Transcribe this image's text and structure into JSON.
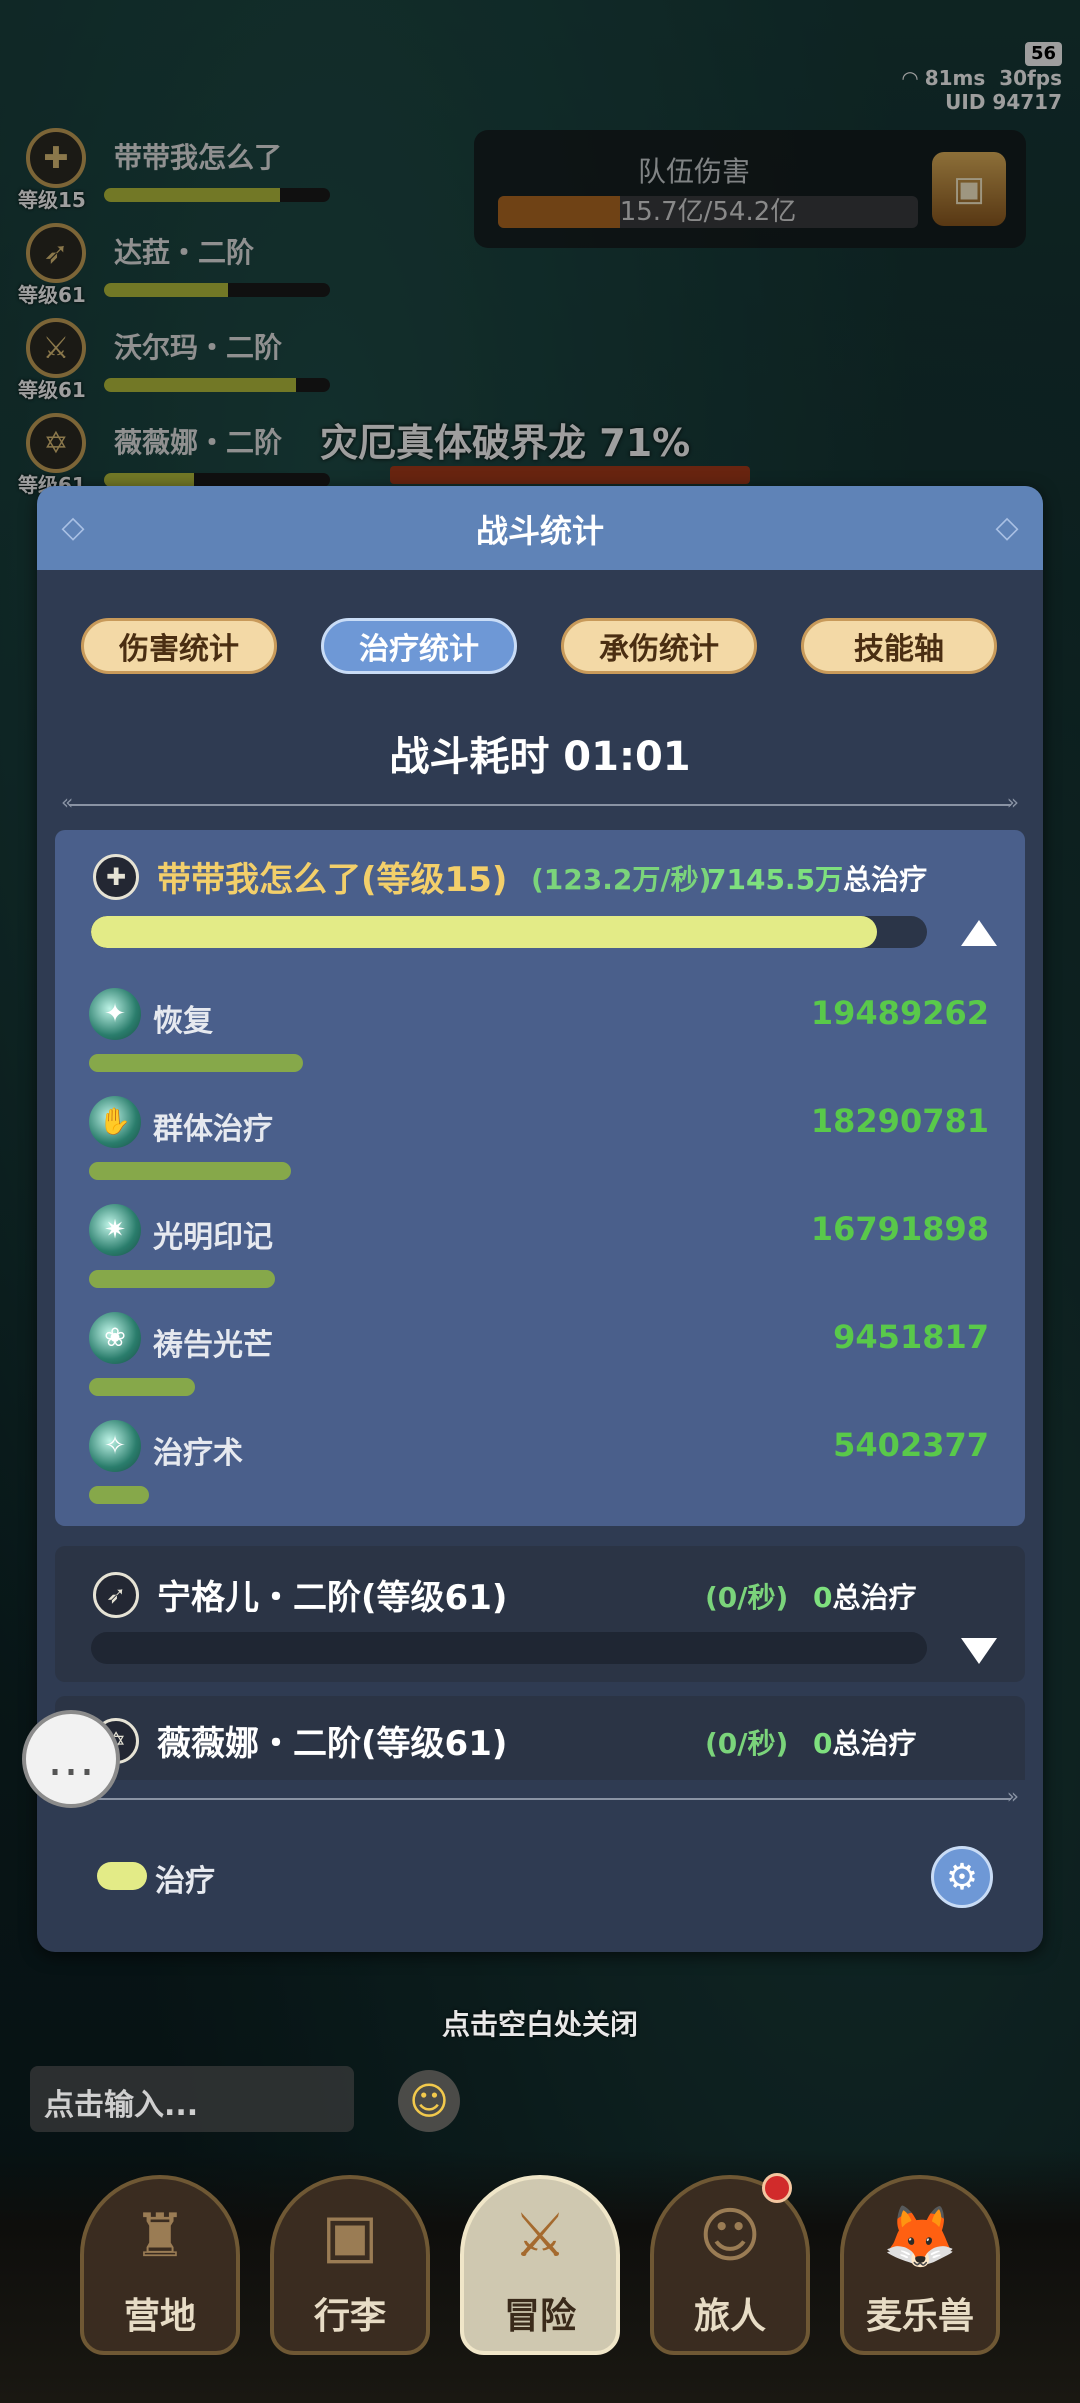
{
  "status": {
    "battery": "56",
    "ping": "81ms",
    "fps": "30fps",
    "uid_label": "UID",
    "uid": "94717"
  },
  "party": [
    {
      "name": "带带我怎么了",
      "level": "等级15",
      "hp_fraction": 0.78
    },
    {
      "name": "达菈・二阶",
      "level": "等级61",
      "hp_fraction": 0.55
    },
    {
      "name": "沃尔玛・二阶",
      "level": "等级61",
      "hp_fraction": 0.85
    },
    {
      "name": "薇薇娜・二阶",
      "level": "等级61",
      "hp_fraction": 0.4
    }
  ],
  "team_damage": {
    "label": "队伍伤害",
    "value": "15.7亿/54.2亿",
    "fraction": 0.29
  },
  "boss": {
    "name": "灾厄真体破界龙",
    "percent": "71%"
  },
  "panel": {
    "title": "战斗统计",
    "tabs": [
      {
        "label": "伤害统计",
        "active": false
      },
      {
        "label": "治疗统计",
        "active": true
      },
      {
        "label": "承伤统计",
        "active": false
      },
      {
        "label": "技能轴",
        "active": false
      }
    ],
    "duration_label": "战斗耗时",
    "duration_value": "01:01",
    "cards": [
      {
        "name": "带带我怎么了(等级15)",
        "rate": "(123.2万/秒)",
        "total_value": "7145.5万",
        "total_label": "总治疗",
        "fraction": 0.94,
        "expanded": true,
        "skills": [
          {
            "name": "恢复",
            "value": "19489262",
            "fraction": 0.237
          },
          {
            "name": "群体治疗",
            "value": "18290781",
            "fraction": 0.222
          },
          {
            "name": "光明印记",
            "value": "16791898",
            "fraction": 0.204
          },
          {
            "name": "祷告光芒",
            "value": "9451817",
            "fraction": 0.115
          },
          {
            "name": "治疗术",
            "value": "5402377",
            "fraction": 0.066
          }
        ]
      },
      {
        "name": "宁格儿・二阶(等级61)",
        "rate": "(0/秒)",
        "total_value": "0",
        "total_label": "总治疗",
        "fraction": 0,
        "expanded": false
      },
      {
        "name": "薇薇娜・二阶(等级61)",
        "rate": "(0/秒)",
        "total_value": "0",
        "total_label": "总治疗",
        "fraction": 0,
        "expanded": false
      }
    ],
    "legend": "治疗"
  },
  "close_hint": "点击空白处关闭",
  "chat_input": {
    "placeholder": "点击输入..."
  },
  "nav": [
    {
      "label": "营地",
      "icon": "castle-icon",
      "active": false
    },
    {
      "label": "行李",
      "icon": "chest-icon",
      "active": false
    },
    {
      "label": "冒险",
      "icon": "crossed-swords-icon",
      "active": true
    },
    {
      "label": "旅人",
      "icon": "hero-icon",
      "active": false,
      "badge": true
    },
    {
      "label": "麦乐兽",
      "icon": "fox-icon",
      "active": false
    }
  ],
  "colors": {
    "panel_bg": "#2f3b52",
    "panel_header": "#5f83b7",
    "active_card": "#4a5f8b",
    "heal_bar": "#e3eb87",
    "skill_bar": "#86a84a",
    "skill_value": "#59c94a",
    "tab_active": "#6e98d6",
    "tab_inactive": "#f3d9a6"
  }
}
